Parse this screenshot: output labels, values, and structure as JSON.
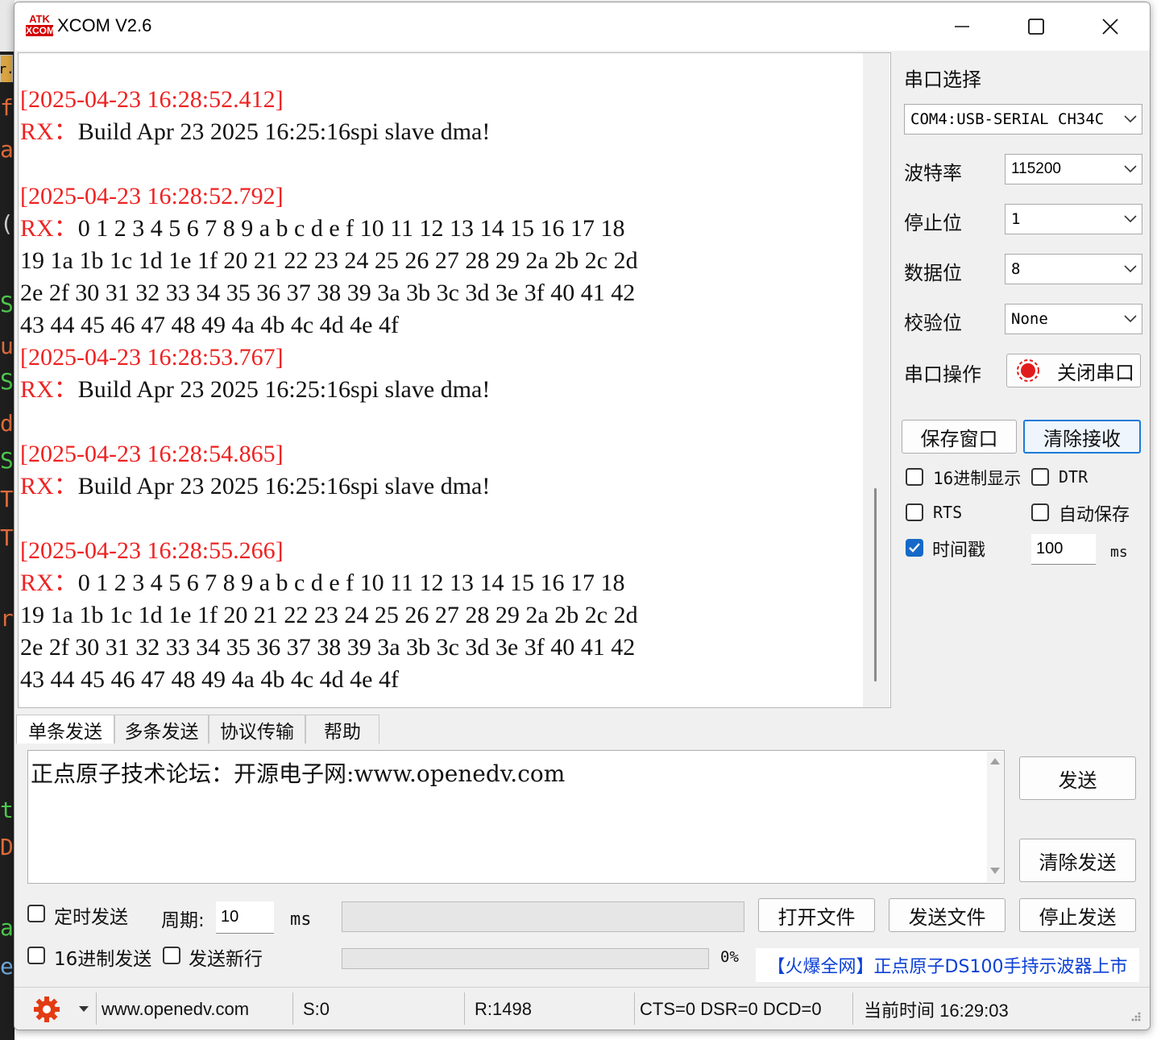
{
  "window": {
    "title": "XCOM V2.6",
    "logo_top": "ATK",
    "logo_bottom": "XCOM"
  },
  "colors": {
    "timestamp": "#ee2222",
    "accent": "#1669c8",
    "link": "#0b3fd6"
  },
  "receive": {
    "lines": [
      {
        "type": "text",
        "text": "  "
      },
      {
        "type": "ts",
        "text": "[2025-04-23 16:28:52.412]"
      },
      {
        "type": "rx",
        "prefix": "RX：",
        "text": "Build Apr 23 2025 16:25:16spi slave dma!"
      },
      {
        "type": "blank",
        "text": ""
      },
      {
        "type": "ts",
        "text": "[2025-04-23 16:28:52.792]"
      },
      {
        "type": "rx",
        "prefix": "RX：",
        "text": "0 1 2 3 4 5 6 7 8 9 a b c d e f 10 11 12 13 14 15 16 17 18"
      },
      {
        "type": "text",
        "text": "19 1a 1b 1c 1d 1e 1f 20 21 22 23 24 25 26 27 28 29 2a 2b 2c 2d"
      },
      {
        "type": "text",
        "text": "2e 2f 30 31 32 33 34 35 36 37 38 39 3a 3b 3c 3d 3e 3f 40 41 42"
      },
      {
        "type": "text",
        "text": "43 44 45 46 47 48 49 4a 4b 4c 4d 4e 4f"
      },
      {
        "type": "ts",
        "text": "[2025-04-23 16:28:53.767]"
      },
      {
        "type": "rx",
        "prefix": "RX：",
        "text": "Build Apr 23 2025 16:25:16spi slave dma!"
      },
      {
        "type": "blank",
        "text": ""
      },
      {
        "type": "ts",
        "text": "[2025-04-23 16:28:54.865]"
      },
      {
        "type": "rx",
        "prefix": "RX：",
        "text": "Build Apr 23 2025 16:25:16spi slave dma!"
      },
      {
        "type": "blank",
        "text": ""
      },
      {
        "type": "ts",
        "text": "[2025-04-23 16:28:55.266]"
      },
      {
        "type": "rx",
        "prefix": "RX：",
        "text": "0 1 2 3 4 5 6 7 8 9 a b c d e f 10 11 12 13 14 15 16 17 18"
      },
      {
        "type": "text",
        "text": "19 1a 1b 1c 1d 1e 1f 20 21 22 23 24 25 26 27 28 29 2a 2b 2c 2d"
      },
      {
        "type": "text",
        "text": "2e 2f 30 31 32 33 34 35 36 37 38 39 3a 3b 3c 3d 3e 3f 40 41 42"
      },
      {
        "type": "text",
        "text": "43 44 45 46 47 48 49 4a 4b 4c 4d 4e 4f"
      }
    ]
  },
  "settings": {
    "port_select_label": "串口选择",
    "port_value": "COM4:USB-SERIAL CH34C",
    "baud_label": "波特率",
    "baud_value": "115200",
    "stop_label": "停止位",
    "stop_value": "1",
    "data_label": "数据位",
    "data_value": "8",
    "parity_label": "校验位",
    "parity_value": "None",
    "op_label": "串口操作",
    "op_button": "关闭串口",
    "save_window": "保存窗口",
    "clear_receive": "清除接收",
    "hex_display": "16进制显示",
    "dtr": "DTR",
    "rts": "RTS",
    "auto_save": "自动保存",
    "timestamp": "时间戳",
    "timestamp_value": "100",
    "timestamp_unit": "ms"
  },
  "tabs": [
    "单条发送",
    "多条发送",
    "协议传输",
    "帮助"
  ],
  "send": {
    "text": "正点原子技术论坛：开源电子网:www.openedv.com",
    "send_button": "发送",
    "clear_button": "清除发送",
    "timed_send": "定时发送",
    "period_label": "周期:",
    "period_value": "10",
    "period_unit": "ms",
    "open_file": "打开文件",
    "send_file": "发送文件",
    "stop_send": "停止发送",
    "hex_send": "16进制发送",
    "new_line": "发送新行",
    "progress_text": "0%",
    "progress_value": 0,
    "ad_text": "【火爆全网】正点原子DS100手持示波器上市"
  },
  "status": {
    "site": "www.openedv.com",
    "sent": "S:0",
    "received": "R:1498",
    "lines": "CTS=0 DSR=0 DCD=0",
    "time": "当前时间 16:29:03"
  },
  "background_window": {
    "tab_text": "r."
  }
}
